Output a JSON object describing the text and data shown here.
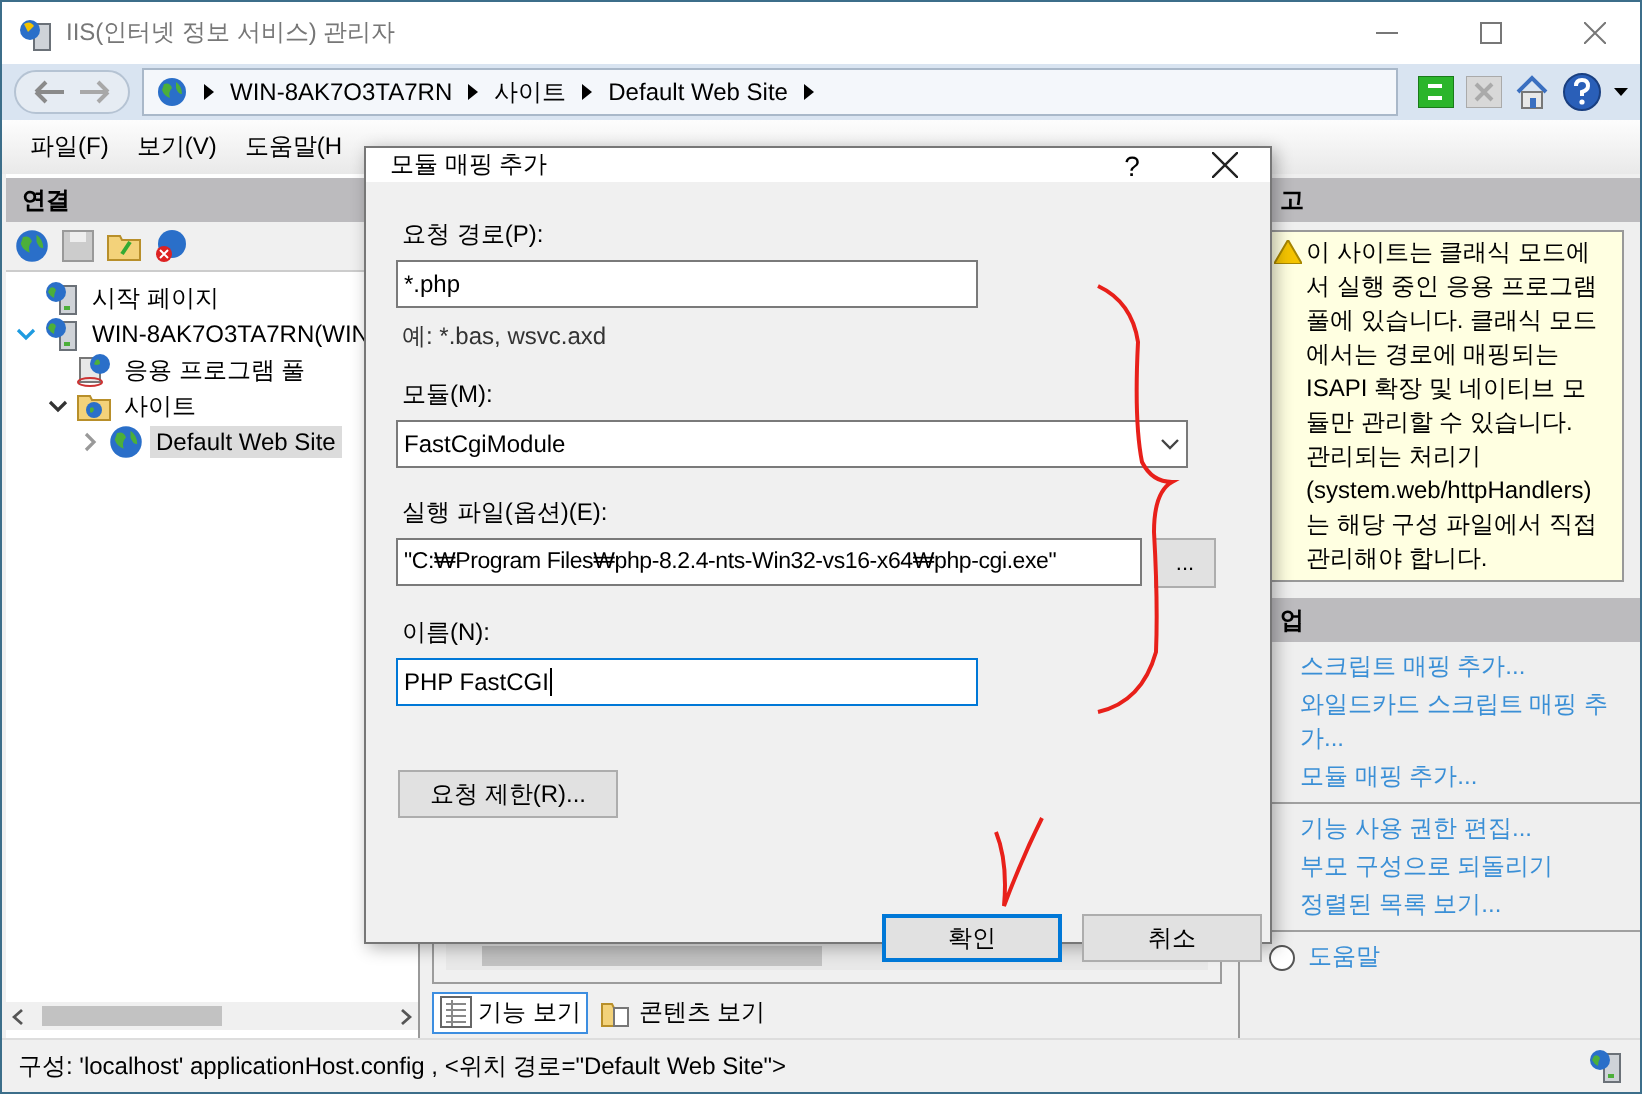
{
  "window": {
    "title": "IIS(인터넷 정보 서비스) 관리자"
  },
  "address_bar": {
    "path": [
      "WIN-8AK7O3TA7RN",
      "사이트",
      "Default Web Site"
    ]
  },
  "menu": [
    "파일(F)",
    "보기(V)",
    "도움말(H"
  ],
  "connections": {
    "title": "연결",
    "tree": [
      {
        "label": "시작 페이지",
        "kind": "start-page",
        "selected": false
      },
      {
        "label": "WIN-8AK7O3TA7RN(WIN",
        "kind": "server",
        "expanded": true,
        "selected": false,
        "children": [
          {
            "label": "응용 프로그램 풀",
            "kind": "app-pools",
            "selected": false
          },
          {
            "label": "사이트",
            "kind": "sites",
            "expanded": true,
            "selected": false,
            "children": [
              {
                "label": "Default Web Site",
                "kind": "site",
                "expanded": false,
                "selected": true
              }
            ]
          }
        ]
      }
    ]
  },
  "view_tabs": [
    {
      "label": "기능 보기",
      "selected": true
    },
    {
      "label": "콘텐츠 보기",
      "selected": false
    }
  ],
  "right_panel": {
    "alerts_title": "고",
    "alert": "이 사이트는 클래식 모드에서 실행 중인 응용 프로그램 풀에 있습니다. 클래식 모드에서는 경로에 매핑되는 ISAPI 확장 및 네이티브 모듈만 관리할 수 있습니다. 관리되는 처리기(system.web/httpHandlers)는 해당 구성 파일에서 직접 관리해야 합니다.",
    "actions_title": "업",
    "action_groups": [
      [
        "스크립트 매핑 추가...",
        "와일드카드 스크립트 매핑 추가...",
        "모듈 매핑 추가..."
      ],
      [
        "기능 사용 권한 편집...",
        "부모 구성으로 되돌리기",
        "정렬된 목록 보기..."
      ],
      [
        "도움말"
      ]
    ]
  },
  "dialog": {
    "title": "모듈 매핑 추가",
    "help": "?",
    "fields": [
      {
        "kind": "text",
        "label": "요청 경로(P):",
        "value": "*.php",
        "hint": "예: *.bas, wsvc.axd",
        "focused": false
      },
      {
        "kind": "dropdown",
        "label": "모듈(M):",
        "value": "FastCgiModule",
        "focused": false
      },
      {
        "kind": "file",
        "label": "실행 파일(옵션)(E):",
        "value": "\"C:₩Program Files₩php-8.2.4-nts-Win32-vs16-x64₩php-cgi.exe\"",
        "browse": "...",
        "focused": false
      },
      {
        "kind": "text",
        "label": "이름(N):",
        "value": "PHP FastCGI",
        "focused": true
      }
    ],
    "limits_button": "요청 제한(R)...",
    "buttons": [
      {
        "label": "확인",
        "default": true
      },
      {
        "label": "취소",
        "default": false
      }
    ]
  },
  "annotations": {
    "brace_marked": true,
    "check_marked": true
  },
  "status_bar": "구성: 'localhost' applicationHost.config , <위치 경로=\"Default Web Site\">"
}
